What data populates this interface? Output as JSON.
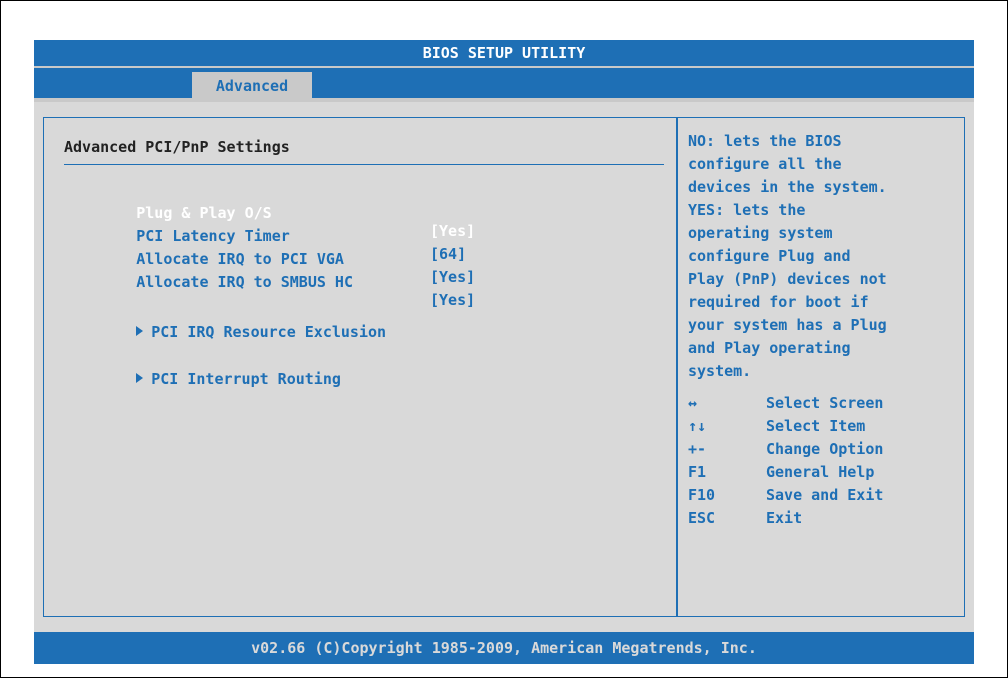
{
  "title": "BIOS SETUP UTILITY",
  "active_tab": "Advanced",
  "section_title": "Advanced PCI/PnP Settings",
  "settings": [
    {
      "label": "Plug & Play O/S",
      "value": "[Yes]",
      "selected": true
    },
    {
      "label": "PCI Latency Timer",
      "value": "[64]",
      "selected": false
    },
    {
      "label": "Allocate IRQ to PCI VGA",
      "value": "[Yes]",
      "selected": false
    },
    {
      "label": "Allocate IRQ to SMBUS HC",
      "value": "[Yes]",
      "selected": false
    }
  ],
  "submenus": [
    {
      "label": "PCI IRQ Resource Exclusion"
    },
    {
      "label": "PCI Interrupt Routing"
    }
  ],
  "help_lines": [
    "NO: lets the BIOS",
    "configure all the",
    "devices in the system.",
    "YES: lets the",
    "operating system",
    "configure Plug and",
    "Play (PnP) devices not",
    "required for boot if",
    "your system has a Plug",
    "and Play operating",
    "system."
  ],
  "keys": [
    {
      "key": "↔",
      "desc": "Select Screen"
    },
    {
      "key": "↑↓",
      "desc": "Select Item"
    },
    {
      "key": "+-",
      "desc": "Change Option"
    },
    {
      "key": "F1",
      "desc": "General Help"
    },
    {
      "key": "F10",
      "desc": "Save and Exit"
    },
    {
      "key": "ESC",
      "desc": "Exit"
    }
  ],
  "footer": "v02.66 (C)Copyright 1985-2009, American Megatrends, Inc.",
  "colors": {
    "accent": "#1e6fb5",
    "panel": "#d9d9d9",
    "selected_text": "#ffffff"
  }
}
